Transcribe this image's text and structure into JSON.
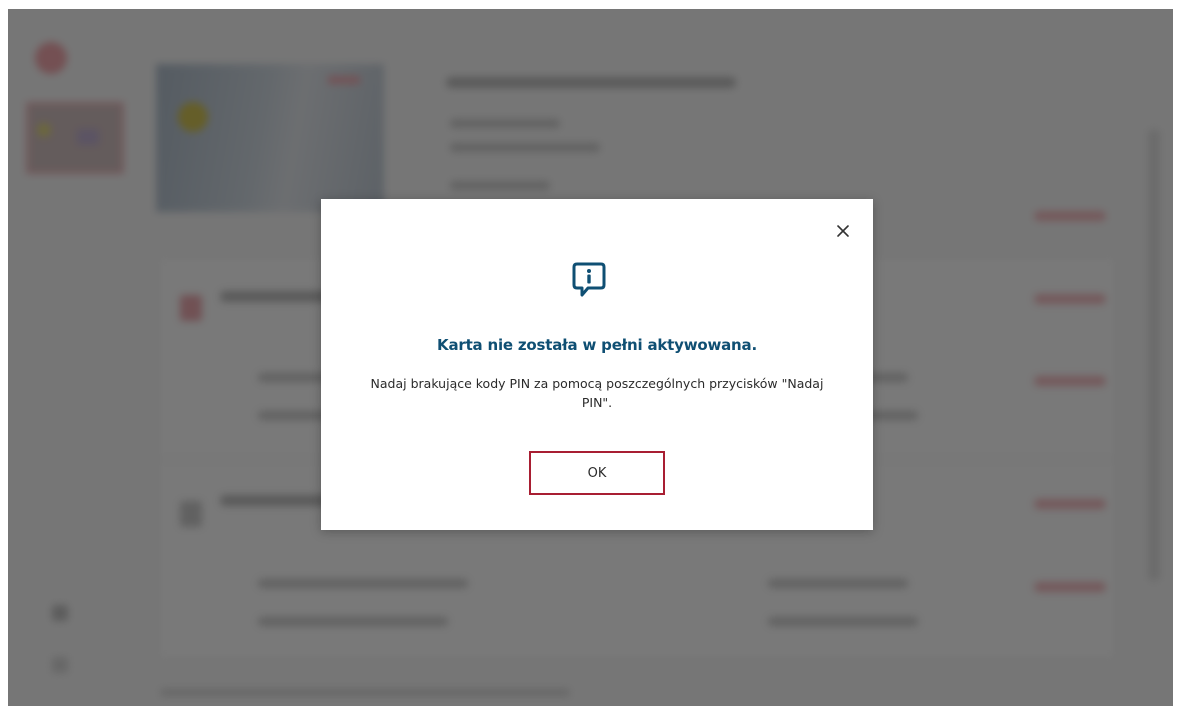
{
  "modal": {
    "title": "Karta nie została w pełni aktywowana.",
    "message": "Nadaj brakujące kody PIN za pomocą poszczególnych przycisków \"Nadaj PIN\".",
    "ok_label": "OK",
    "icons": {
      "close": "close-icon",
      "info": "info-chat-icon"
    }
  },
  "colors": {
    "title": "#0f4f73",
    "ok_border": "#a81e32",
    "info_icon": "#0f4f73"
  }
}
